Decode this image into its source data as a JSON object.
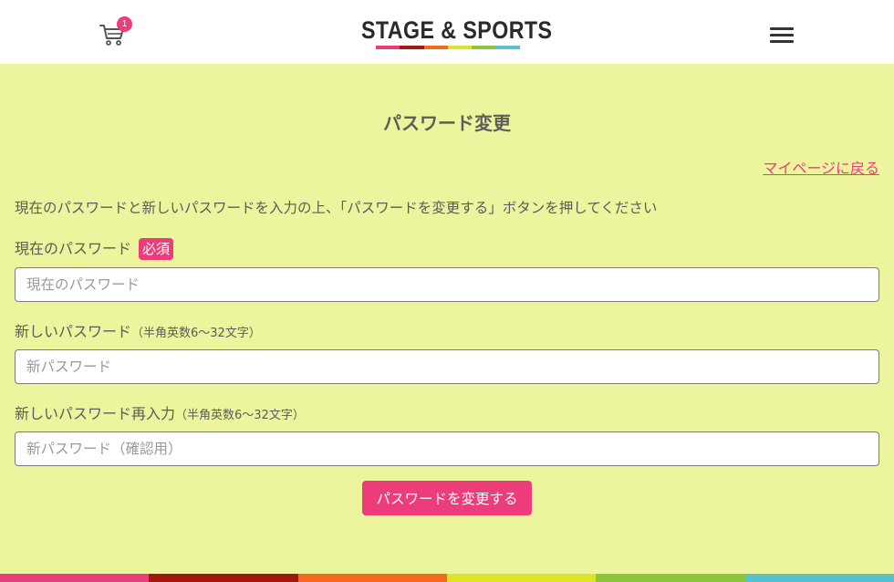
{
  "header": {
    "cart_count": "1",
    "logo_text": "STAGE & SPORTS",
    "logo_colors": [
      "#ec3d7a",
      "#a0190f",
      "#f26a1c",
      "#dde32a",
      "#8cc63f",
      "#5bc0c9"
    ]
  },
  "page": {
    "title": "パスワード変更",
    "back_link": "マイページに戻る",
    "instruction": "現在のパスワードと新しいパスワードを入力の上、「パスワードを変更する」ボタンを押してください"
  },
  "form": {
    "current": {
      "label": "現在のパスワード",
      "required": "必須",
      "placeholder": "現在のパスワード"
    },
    "new": {
      "label": "新しいパスワード",
      "note": "（半角英数6〜32文字）",
      "placeholder": "新パスワード"
    },
    "confirm": {
      "label": "新しいパスワード再入力",
      "note": "（半角英数6〜32文字）",
      "placeholder": "新パスワード（確認用）"
    },
    "submit_label": "パスワードを変更する"
  },
  "colors": {
    "accent": "#ec3d7a",
    "background": "#ecf59d",
    "footer_stripes": [
      "#ec3d7a",
      "#a0190f",
      "#f26a1c",
      "#dde32a",
      "#8cc63f",
      "#5bc0c9"
    ]
  }
}
